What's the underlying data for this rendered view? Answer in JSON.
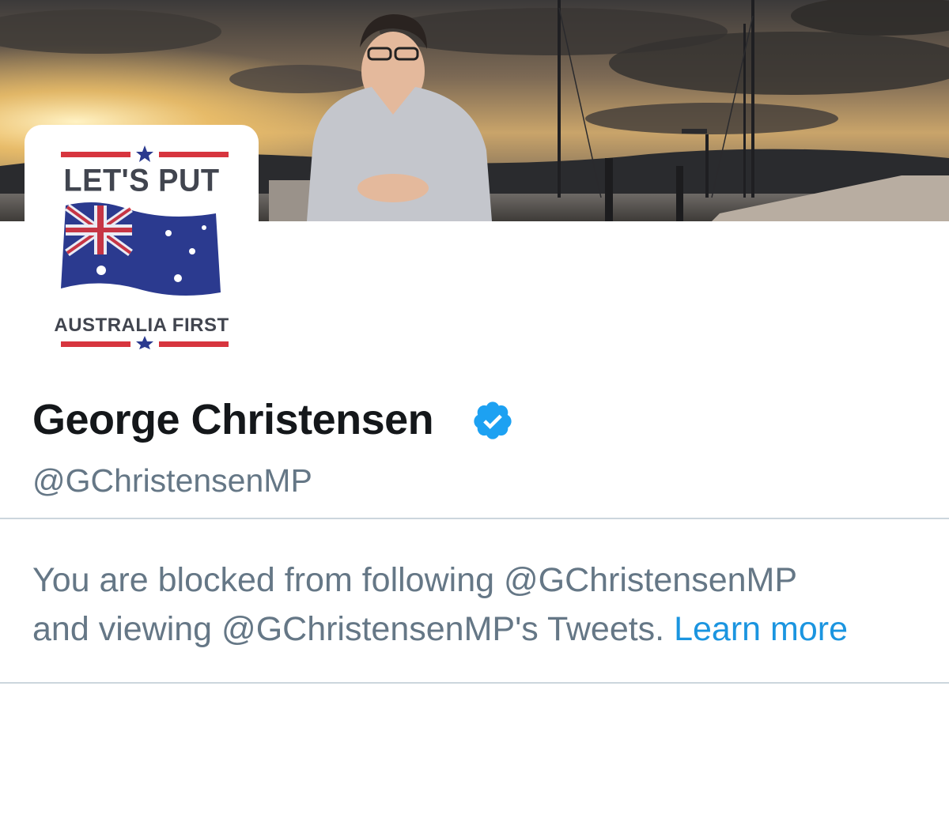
{
  "profile": {
    "display_name": "George Christensen",
    "verified": true,
    "handle": "@GChristensenMP",
    "avatar": {
      "top_text": "LET'S PUT",
      "bottom_text": "AUSTRALIA FIRST"
    }
  },
  "notice": {
    "line1": "You are blocked from following @GChristensenMP",
    "line2": "and viewing @GChristensenMP's Tweets.",
    "learn_more": "Learn more"
  },
  "colors": {
    "name": "#14171a",
    "secondary_text": "#657786",
    "link": "#1b95e0",
    "verified": "#1da1f2",
    "divider": "#ccd6dd",
    "avatar_red": "#d7353e",
    "avatar_blue": "#2b3a8f"
  },
  "icons": {
    "verified_badge": "verified-badge-icon"
  }
}
